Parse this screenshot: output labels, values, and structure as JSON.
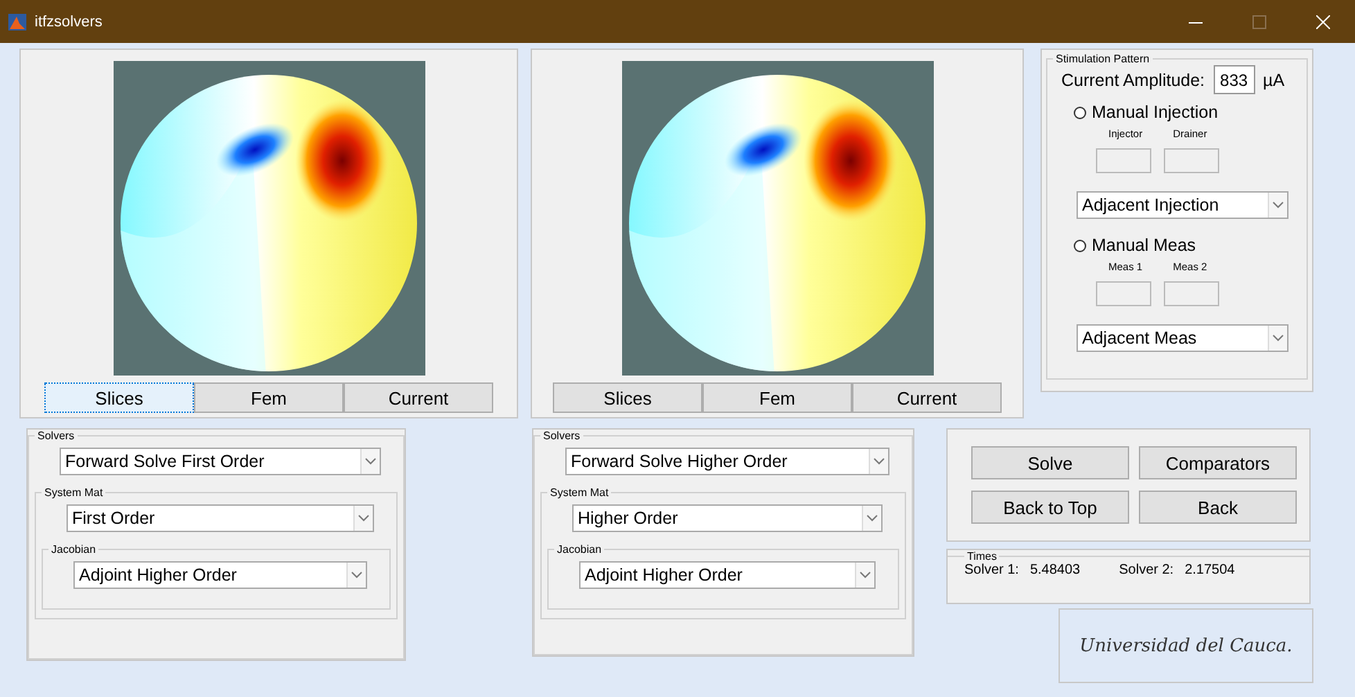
{
  "window": {
    "title": "itfzsolvers"
  },
  "views": [
    {
      "tabs": [
        {
          "label": "Slices",
          "selected": true
        },
        {
          "label": "Fem",
          "selected": false
        },
        {
          "label": "Current",
          "selected": false
        }
      ],
      "solvers": {
        "legend": "Solvers",
        "value": "Forward Solve First Order"
      },
      "system_mat": {
        "legend": "System Mat",
        "value": "First Order"
      },
      "jacobian": {
        "legend": "Jacobian",
        "value": "Adjoint Higher Order"
      }
    },
    {
      "tabs": [
        {
          "label": "Slices",
          "selected": false
        },
        {
          "label": "Fem",
          "selected": false
        },
        {
          "label": "Current",
          "selected": false
        }
      ],
      "solvers": {
        "legend": "Solvers",
        "value": "Forward Solve Higher Order"
      },
      "system_mat": {
        "legend": "System Mat",
        "value": "Higher Order"
      },
      "jacobian": {
        "legend": "Jacobian",
        "value": "Adjoint Higher Order"
      }
    }
  ],
  "stimulation": {
    "legend": "Stimulation Pattern",
    "amplitude_label": "Current Amplitude:",
    "amplitude": "833",
    "unit": "µA",
    "groups": [
      {
        "label": "Manual Injection",
        "selected": false,
        "field_labels": [
          "Injector",
          "Drainer"
        ],
        "dropdown": "Adjacent Injection"
      },
      {
        "label": "Manual Meas",
        "selected": false,
        "field_labels": [
          "Meas 1",
          "Meas 2"
        ],
        "dropdown": "Adjacent Meas"
      }
    ]
  },
  "buttons": [
    "Solve",
    "Comparators",
    "Back to Top",
    "Back"
  ],
  "times": {
    "legend": "Times",
    "entries": [
      {
        "label": "Solver 1:",
        "value": "5.48403"
      },
      {
        "label": "Solver 2:",
        "value": "2.17504"
      }
    ]
  },
  "logo": "Universidad del Cauca."
}
